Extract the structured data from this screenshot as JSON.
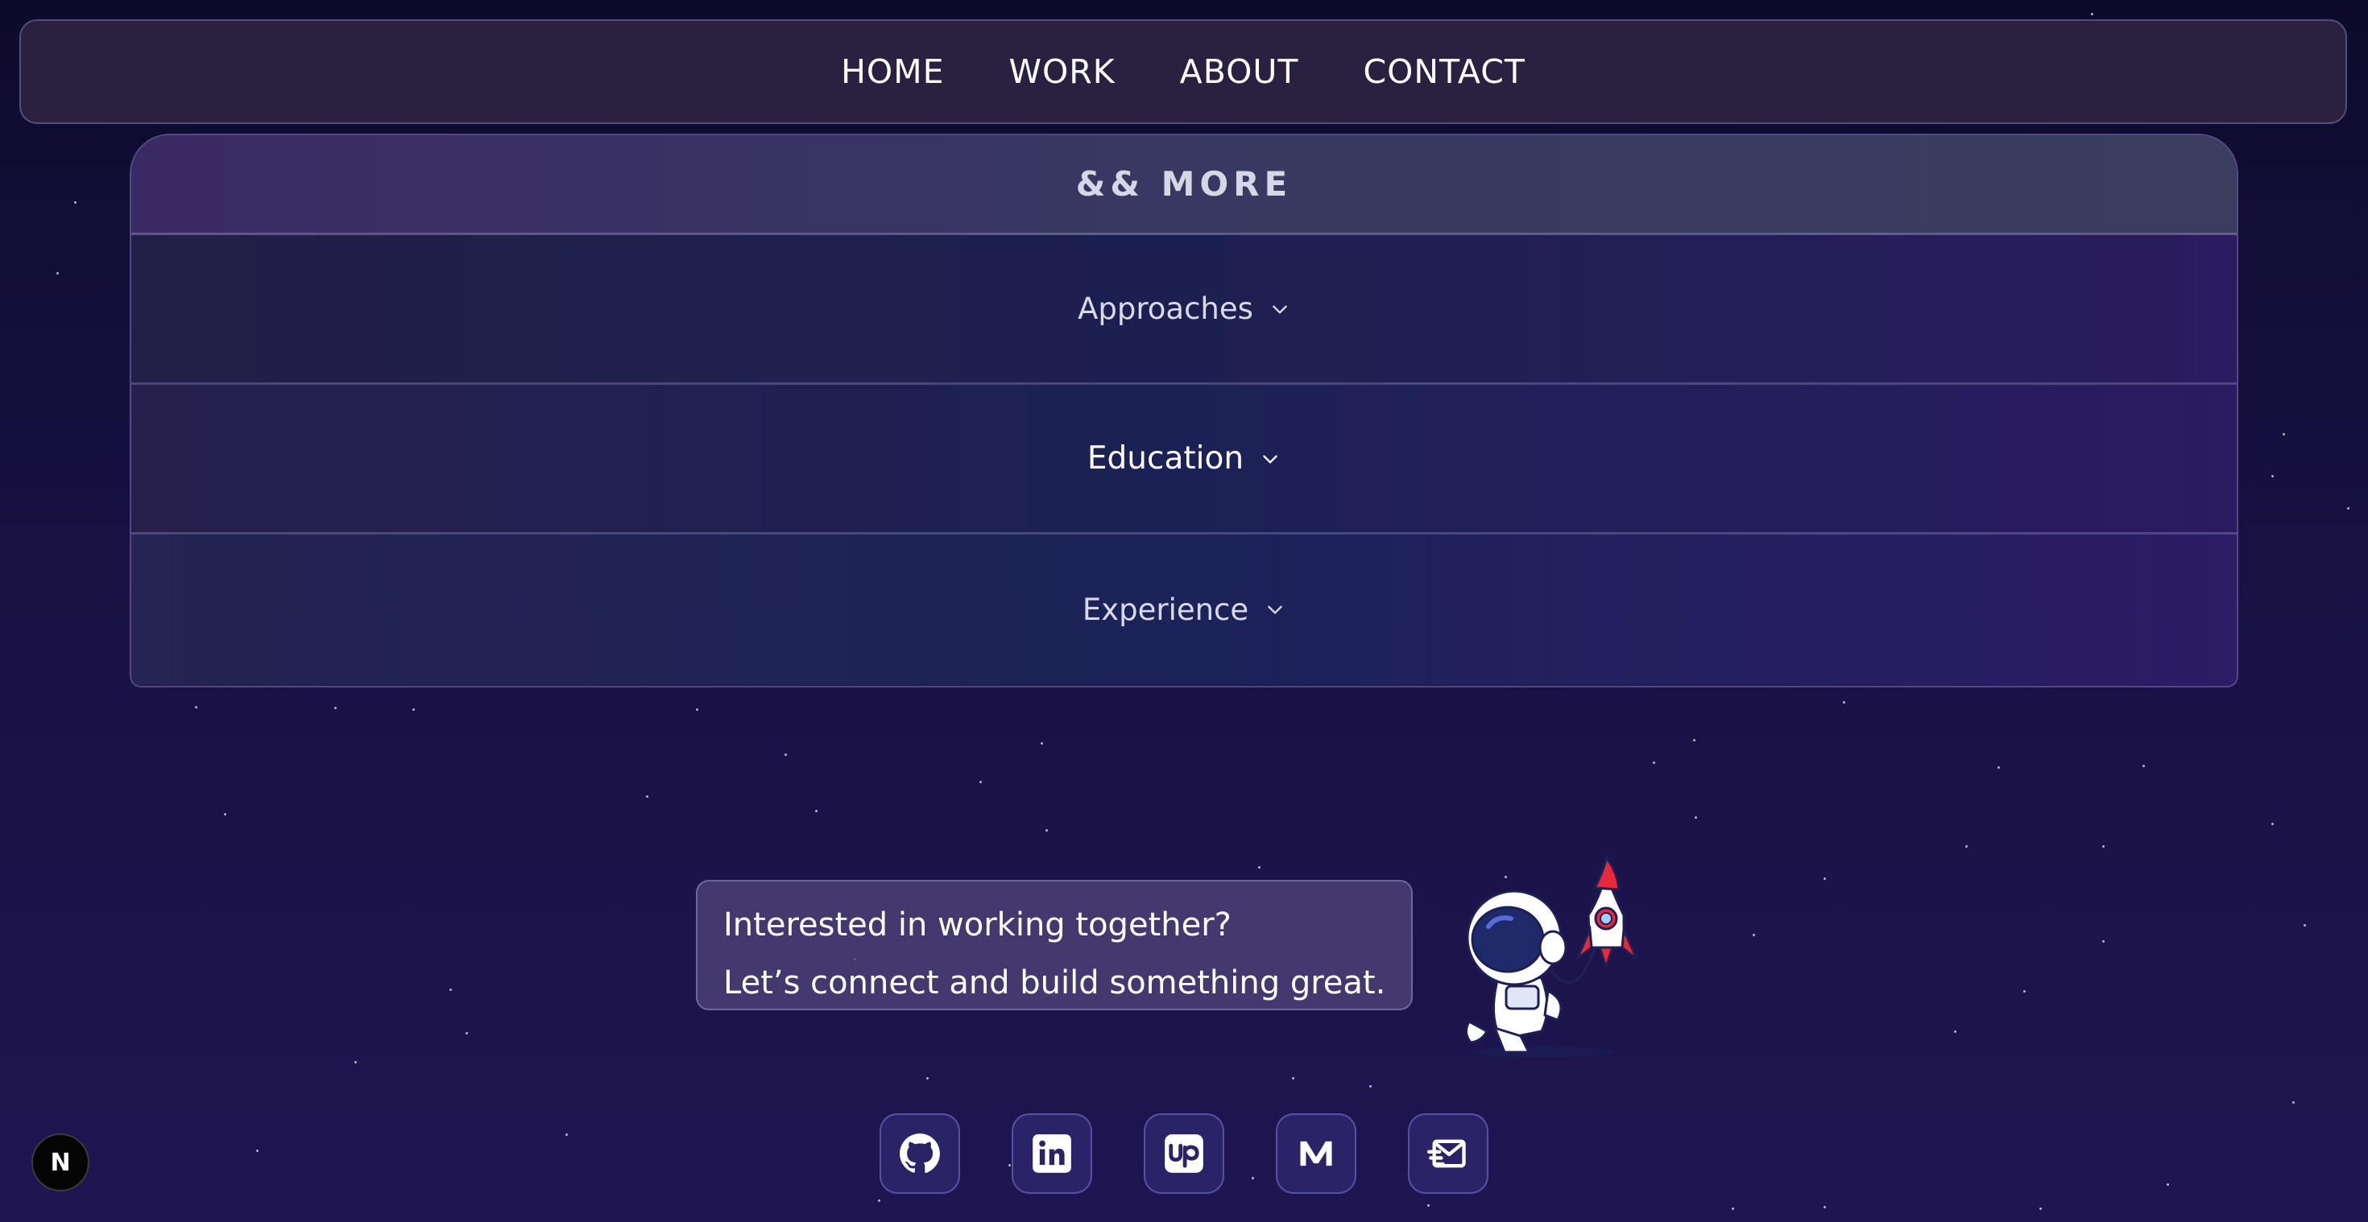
{
  "nav": {
    "items": [
      {
        "label": "HOME"
      },
      {
        "label": "WORK"
      },
      {
        "label": "ABOUT"
      },
      {
        "label": "CONTACT"
      }
    ]
  },
  "more_section": {
    "title": "&& MORE",
    "items": [
      {
        "label": "Approaches",
        "expanded": false
      },
      {
        "label": "Education",
        "expanded": false
      },
      {
        "label": "Experience",
        "expanded": false
      }
    ]
  },
  "cta": {
    "line1": "Interested in working together?",
    "line2": "Let’s connect and build something great."
  },
  "socials": [
    {
      "icon": "github-icon"
    },
    {
      "icon": "linkedin-icon"
    },
    {
      "icon": "upwork-icon"
    },
    {
      "icon": "medium-icon"
    },
    {
      "icon": "mail-icon"
    }
  ],
  "badge": {
    "letter": "N"
  },
  "colors": {
    "background": "#140f3a",
    "nav_bg": "#2c2442",
    "card_header": "#383a62",
    "social_bg": "#2a2368",
    "rocket_red": "#e8293b"
  }
}
